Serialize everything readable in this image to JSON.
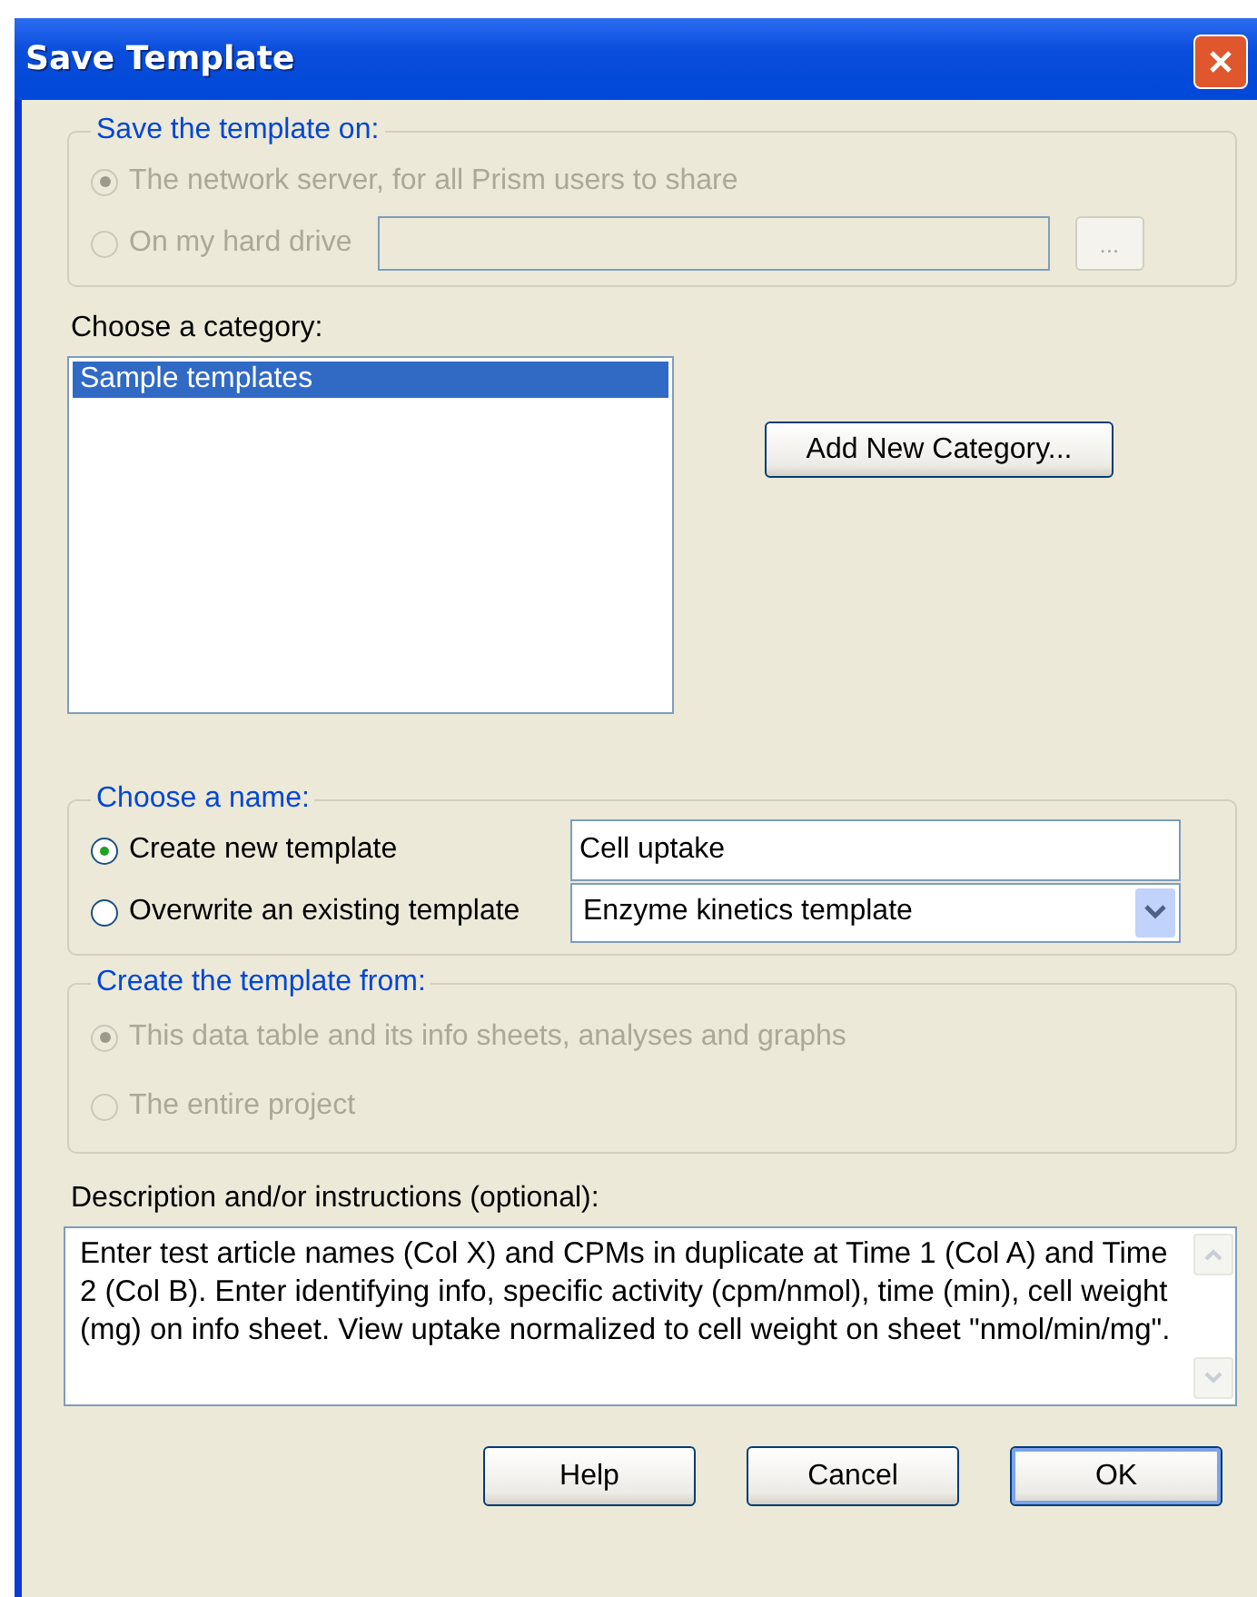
{
  "window": {
    "title": "Save Template"
  },
  "save_on": {
    "title": "Save the template on:",
    "disabled": true,
    "options": [
      {
        "label": "The network server, for all Prism users to share",
        "selected": true
      },
      {
        "label": "On my hard drive",
        "selected": false
      }
    ],
    "browse_button": "..."
  },
  "category": {
    "label": "Choose a category:",
    "items": [
      {
        "label": "Sample templates",
        "selected": true
      }
    ],
    "add_button": "Add New Category..."
  },
  "choose_name": {
    "title": "Choose a name:",
    "disabled": false,
    "options": [
      {
        "label": "Create new template",
        "selected": true
      },
      {
        "label": "Overwrite an existing template",
        "selected": false
      }
    ],
    "name_value": "Cell uptake",
    "existing_value": "Enzyme kinetics template"
  },
  "create_from": {
    "title": "Create the template from:",
    "disabled": true,
    "options": [
      {
        "label": "This data table and its info sheets, analyses and graphs",
        "selected": true
      },
      {
        "label": "The entire project",
        "selected": false
      }
    ]
  },
  "description": {
    "label": "Description and/or instructions (optional):",
    "value": "Enter test article names (Col X) and CPMs in duplicate at Time 1 (Col A) and Time 2 (Col B). Enter identifying info, specific activity (cpm/nmol), time (min), cell weight (mg) on info sheet. View uptake normalized to cell weight on sheet \"nmol/min/mg\"."
  },
  "buttons": [
    "Help",
    "Cancel",
    "OK"
  ]
}
